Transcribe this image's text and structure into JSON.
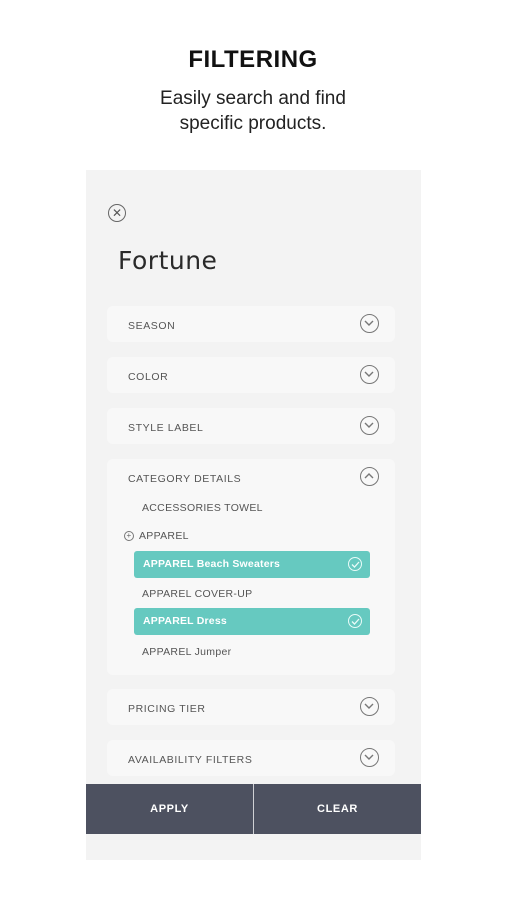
{
  "header": {
    "title": "FILTERING",
    "subtitle_line1": "Easily search and find",
    "subtitle_line2": "specific products."
  },
  "panel": {
    "close_icon": "close-circle-icon",
    "brand": "Fortune",
    "sections": {
      "season": "SEASON",
      "color": "COLOR",
      "style_label": "STYLE LABEL",
      "category_details": "CATEGORY DETAILS",
      "pricing_tier": "PRICING TIER",
      "availability_filters": "AVAILABILITY FILTERS"
    },
    "category_items": {
      "accessories_towel": "ACCESSORIES TOWEL",
      "apparel_parent": "APPAREL",
      "apparel_beach_sweaters": "APPAREL Beach Sweaters",
      "apparel_cover_up": "APPAREL COVER-UP",
      "apparel_dress": "APPAREL Dress",
      "apparel_jumper": "APPAREL Jumper"
    },
    "footer": {
      "apply": "APPLY",
      "clear": "CLEAR"
    }
  },
  "colors": {
    "accent": "#66c9c0",
    "footer_bg": "#4d5160"
  }
}
